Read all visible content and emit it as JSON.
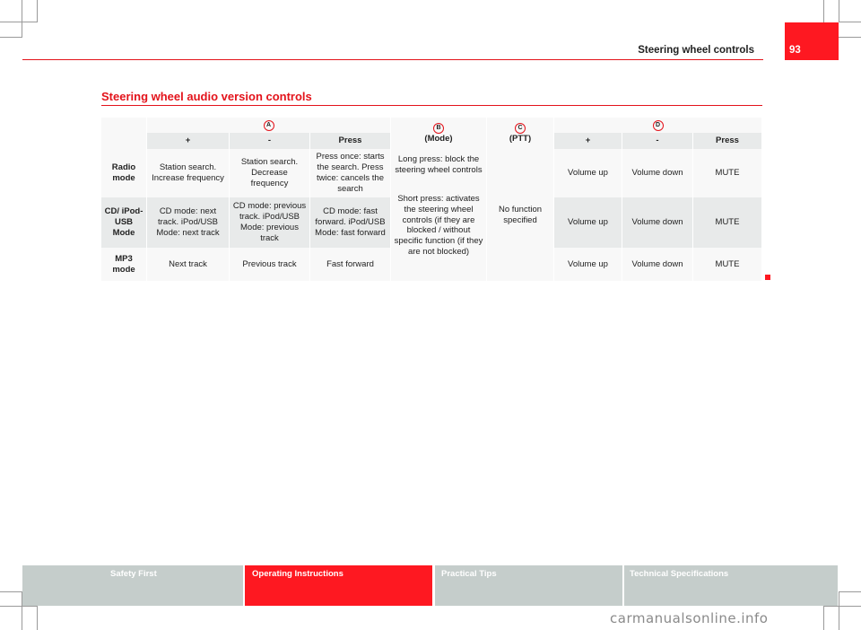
{
  "header": {
    "chapter_title": "Steering wheel controls",
    "page_number": "93"
  },
  "section": {
    "title": "Steering wheel audio version controls"
  },
  "table": {
    "groups": {
      "A": {
        "marker": "A",
        "sub": [
          "+",
          "-",
          "Press"
        ]
      },
      "B": {
        "marker": "B",
        "label": "(Mode)"
      },
      "C": {
        "marker": "C",
        "label": "(PTT)"
      },
      "D": {
        "marker": "D",
        "sub": [
          "+",
          "-",
          "Press"
        ]
      }
    },
    "rows": [
      {
        "mode": "Radio mode",
        "a_plus": "Station search. Increase frequency",
        "a_minus": "Station search. Decrease frequency",
        "a_press": "Press once: starts the search. Press twice: cancels the search",
        "d_plus": "Volume up",
        "d_minus": "Volume down",
        "d_press": "MUTE"
      },
      {
        "mode": "CD/ iPod-USB Mode",
        "a_plus": "CD mode: next track. iPod/USB Mode: next track",
        "a_minus": "CD mode: previous track. iPod/USB Mode: previous track",
        "a_press": "CD mode: fast forward. iPod/USB Mode: fast forward",
        "d_plus": "Volume up",
        "d_minus": "Volume down",
        "d_press": "MUTE"
      },
      {
        "mode": "MP3 mode",
        "a_plus": "Next track",
        "a_minus": "Previous track",
        "a_press": "Fast forward",
        "d_plus": "Volume up",
        "d_minus": "Volume down",
        "d_press": "MUTE"
      }
    ],
    "b_long": "Long press: block the steering wheel controls",
    "b_short": "Short press: activates the steering wheel controls (if they are blocked / without specific function (if they are not blocked)",
    "c_text": "No function specified"
  },
  "footer": {
    "tabs": [
      {
        "label": "Safety First",
        "active": false
      },
      {
        "label": "Operating Instructions",
        "active": true
      },
      {
        "label": "Practical Tips",
        "active": false
      },
      {
        "label": "Technical Specifications",
        "active": false
      }
    ]
  },
  "watermark": "carmanualsonline.info"
}
